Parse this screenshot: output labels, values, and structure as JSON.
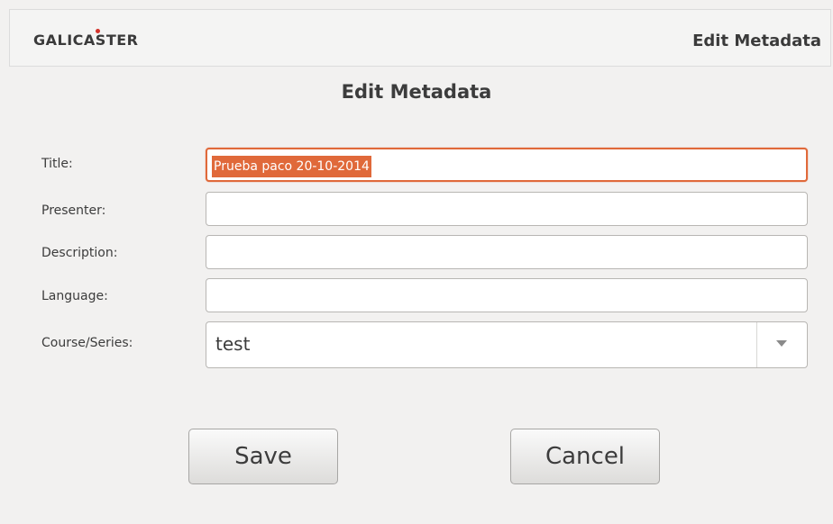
{
  "header": {
    "logo": "GALICASTER",
    "title": "Edit Metadata"
  },
  "dialog": {
    "title": "Edit Metadata"
  },
  "form": {
    "title_label": "Title:",
    "title_value": "Prueba paco 20-10-2014",
    "presenter_label": "Presenter:",
    "presenter_value": "",
    "description_label": "Description:",
    "description_value": "",
    "language_label": "Language:",
    "language_value": "",
    "series_label": "Course/Series:",
    "series_value": "test"
  },
  "buttons": {
    "save": "Save",
    "cancel": "Cancel"
  },
  "colors": {
    "accent": "#e0693a",
    "logo_dot": "#d3332b",
    "background": "#f2f1f0"
  }
}
